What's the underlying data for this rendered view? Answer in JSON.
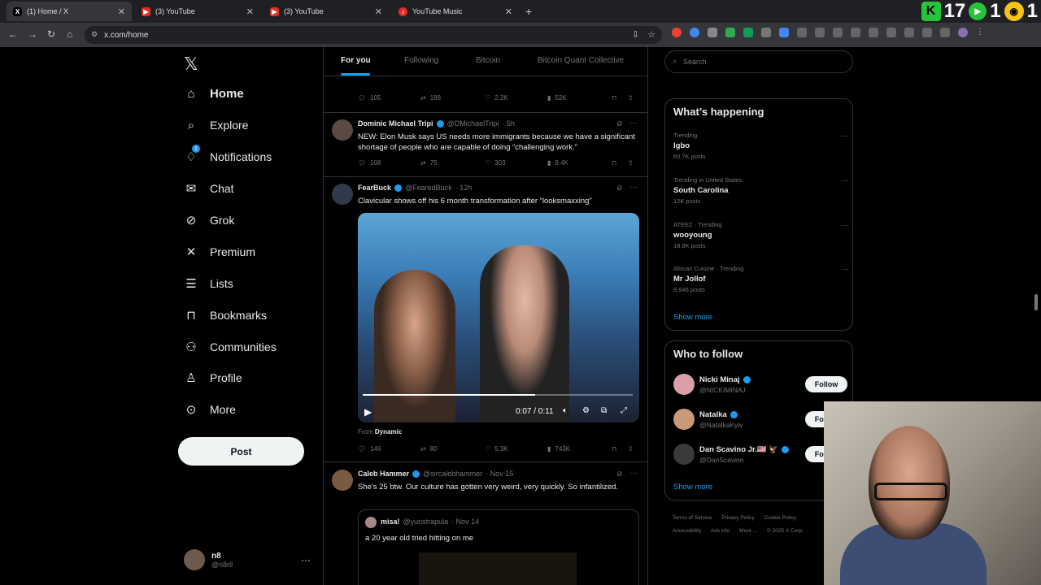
{
  "browser": {
    "tabs": [
      {
        "label": "(1) Home / X",
        "favicon": "X"
      },
      {
        "label": "(3) YouTube",
        "favicon": "▶"
      },
      {
        "label": "(3) YouTube",
        "favicon": "▶"
      },
      {
        "label": "YouTube Music",
        "favicon": "♪"
      }
    ],
    "url": "x.com/home",
    "ext_counts": {
      "k": "17",
      "g": "1",
      "y": "1"
    }
  },
  "nav": {
    "items": [
      {
        "label": "Home",
        "icon": "home-icon"
      },
      {
        "label": "Explore",
        "icon": "search-icon"
      },
      {
        "label": "Notifications",
        "icon": "bell-icon"
      },
      {
        "label": "Chat",
        "icon": "mail-icon"
      },
      {
        "label": "Grok",
        "icon": "grok-icon"
      },
      {
        "label": "Premium",
        "icon": "x-icon"
      },
      {
        "label": "Lists",
        "icon": "list-icon"
      },
      {
        "label": "Bookmarks",
        "icon": "bookmark-icon"
      },
      {
        "label": "Communities",
        "icon": "people-icon"
      },
      {
        "label": "Profile",
        "icon": "person-icon"
      },
      {
        "label": "More",
        "icon": "more-circle-icon"
      }
    ],
    "notif_count": "1",
    "post_label": "Post",
    "account": {
      "name": "n8",
      "handle": "@n8rll"
    }
  },
  "feed": {
    "tabs": [
      "For you",
      "Following",
      "Bitcoin",
      "Bitcoin Quant Collective"
    ],
    "top_actions": {
      "replies": "105",
      "reposts": "188",
      "likes": "2.2K",
      "views": "52K"
    },
    "tweets": [
      {
        "name": "Dominic Michael Tripi",
        "handle": "@DMichaelTripi",
        "time": "· 5h",
        "text": "NEW: Elon Musk says US needs more immigrants because we have a significant shortage of people who are capable of doing “challenging work.”",
        "replies": "108",
        "reposts": "75",
        "likes": "303",
        "views": "9.4K"
      },
      {
        "name": "FearBuck",
        "handle": "@FearedBuck",
        "time": "· 12h",
        "text": "Clavicular shows off his 6 month transformation after “looksmaxxing”",
        "video_time": "0:07 / 0:11",
        "video_progress": 0.64,
        "from_label": "From",
        "from_source": "Dynamic",
        "replies": "146",
        "reposts": "80",
        "likes": "5.3K",
        "views": "743K"
      },
      {
        "name": "Caleb Hammer",
        "handle": "@sircalebhammer",
        "time": "· Nov 15",
        "text": "She's 25 btw. Our culture has gotten very weird, very quickly. So infantilized.",
        "quote": {
          "name": "misa!",
          "handle": "@yuristrapula",
          "time": "· Nov 14",
          "text": "a 20 year old tried hitting on me"
        }
      }
    ]
  },
  "right": {
    "search_placeholder": "Search",
    "happening_title": "What’s happening",
    "trends": [
      {
        "category": "Trending",
        "name": "Igbo",
        "count": "60.7K posts"
      },
      {
        "category": "Trending in United States",
        "name": "South Carolina",
        "count": "12K posts"
      },
      {
        "category": "ATEEZ · Trending",
        "name": "wooyoung",
        "count": "18.8K posts"
      },
      {
        "category": "African Cuisine · Trending",
        "name": "Mr Jollof",
        "count": "9,946 posts"
      }
    ],
    "show_more": "Show more",
    "wtf_title": "Who to follow",
    "follow_suggestions": [
      {
        "name": "Nicki Minaj",
        "handle": "@NICKIMINAJ"
      },
      {
        "name": "Natalka",
        "handle": "@NatalkaKyiv"
      },
      {
        "name": "Dan Scavino Jr.🇺🇸 🦅",
        "handle": "@DanScavino"
      }
    ],
    "follow_label": "Follow",
    "footer": [
      "Terms of Service",
      "Privacy Policy",
      "Cookie Policy",
      "Accessibility",
      "Ads info",
      "More ...",
      "© 2025 X Corp."
    ]
  },
  "colors": {
    "accent": "#1d9bf0",
    "bg": "#000000",
    "border": "#2f3336",
    "muted": "#71767b"
  }
}
